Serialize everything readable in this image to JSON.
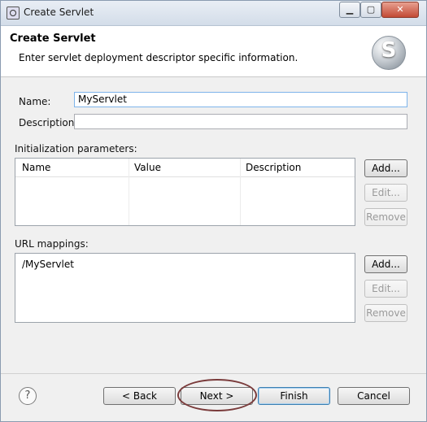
{
  "window": {
    "title": "Create Servlet",
    "min_label": "▁",
    "max_label": "▢",
    "close_label": "✕"
  },
  "header": {
    "title": "Create Servlet",
    "description": "Enter servlet deployment descriptor specific information.",
    "logo_letter": "S"
  },
  "form": {
    "name_label": "Name:",
    "name_value": "MyServlet",
    "description_label": "Description:",
    "description_value": ""
  },
  "init_params": {
    "label": "Initialization parameters:",
    "columns": [
      "Name",
      "Value",
      "Description"
    ],
    "add_label": "Add...",
    "edit_label": "Edit...",
    "remove_label": "Remove"
  },
  "url_mappings": {
    "label": "URL mappings:",
    "items": [
      "/MyServlet"
    ],
    "add_label": "Add...",
    "edit_label": "Edit...",
    "remove_label": "Remove"
  },
  "footer": {
    "help_label": "?",
    "back_label": "< Back",
    "next_label": "Next >",
    "finish_label": "Finish",
    "cancel_label": "Cancel"
  },
  "colors": {
    "annotation_ellipse": "#7a3b3b",
    "default_button_border": "#3c7fb1"
  }
}
